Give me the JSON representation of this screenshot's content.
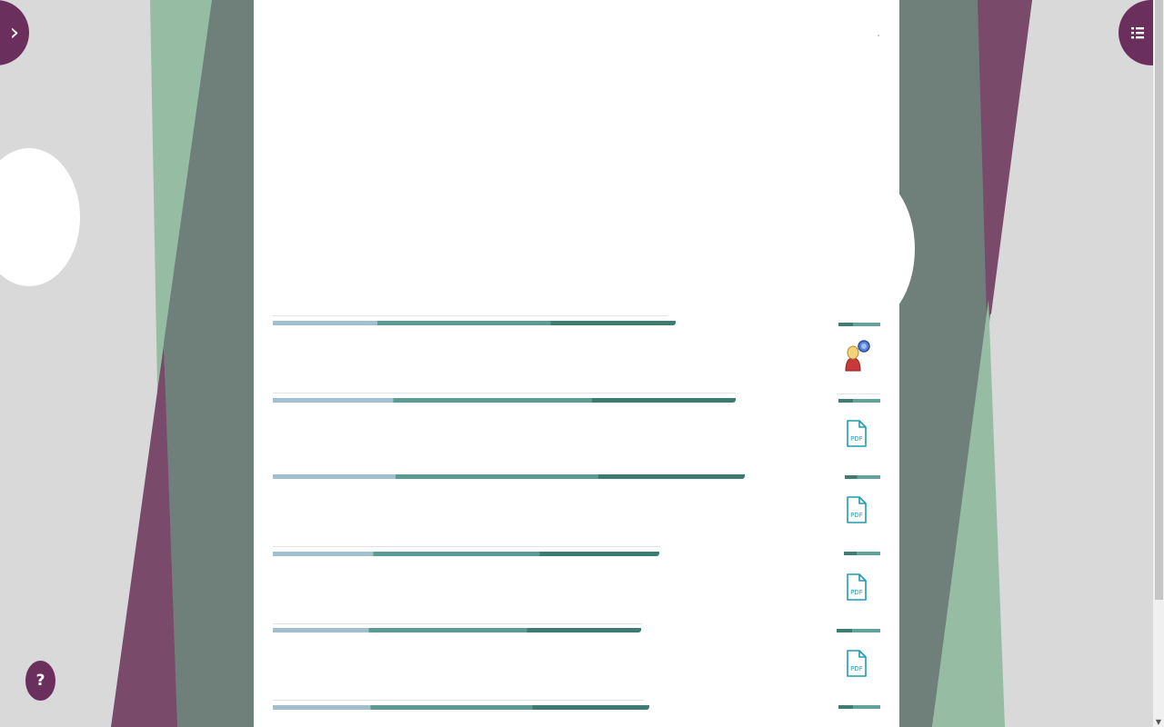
{
  "colors": {
    "background": "#d9d9d9",
    "panel_green_light": "#96bda3",
    "panel_green_dark": "#6e8079",
    "panel_purple": "#7a4a6a",
    "accent_purple": "#6b2f5e",
    "pdf_teal": "#1f9bb3"
  },
  "controls": {
    "open_sidebar_icon": "chevron-right",
    "open_sidebar_glyph": "›",
    "toc_icon": "list",
    "help_label": "?"
  },
  "rows": [
    {
      "icon": "people-icon"
    },
    {
      "icon": "pdf-icon",
      "icon_text": "PDF"
    },
    {
      "icon": "pdf-icon",
      "icon_text": "PDF"
    },
    {
      "icon": "pdf-icon",
      "icon_text": "PDF"
    },
    {
      "icon": "pdf-icon",
      "icon_text": "PDF"
    }
  ]
}
